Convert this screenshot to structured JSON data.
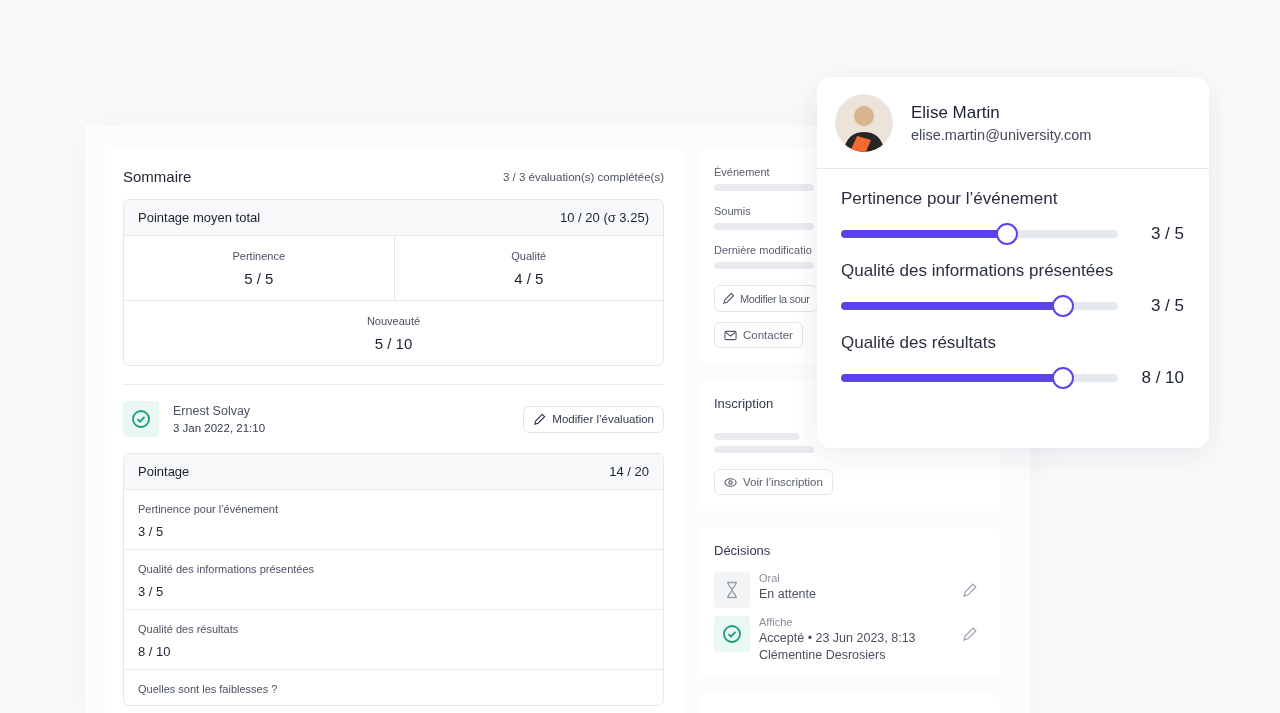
{
  "summary": {
    "title": "Sommaire",
    "completed": "3 / 3 évaluation(s) complétée(s)",
    "total": {
      "label": "Pointage moyen total",
      "value": "10 / 20 (σ 3.25)"
    },
    "criteria": [
      {
        "label": "Pertinence",
        "value": "5 / 5"
      },
      {
        "label": "Qualité",
        "value": "4 / 5"
      },
      {
        "label": "Nouveauté",
        "value": "5 / 10"
      }
    ]
  },
  "evaluation": {
    "reviewer": "Ernest Solvay",
    "date": "3 Jan 2022, 21:10",
    "edit_button": "Modifier l’évaluation",
    "score": {
      "label": "Pointage",
      "value": "14 / 20"
    },
    "fields": [
      {
        "label": "Pertinence pour l’événement",
        "value": "3 / 5"
      },
      {
        "label": "Qualité des informations présentées",
        "value": "3 / 5"
      },
      {
        "label": "Qualité des résultats",
        "value": "8 / 10"
      },
      {
        "label": "Quelles sont les faiblesses ?"
      }
    ]
  },
  "details": {
    "labels": [
      "Événement",
      "Soumis",
      "Dernière modificatio"
    ],
    "edit_button": "Modifier la sour",
    "contact_button": "Contacter"
  },
  "registration": {
    "title": "Inscription",
    "button": "Voir l’inscription"
  },
  "decisions": {
    "title": "Décisions",
    "items": [
      {
        "kind": "pending",
        "type": "Oral",
        "status": "En attente"
      },
      {
        "kind": "accepted",
        "type": "Affiche",
        "status": "Accepté • 23 Jun 2023, 8:13",
        "by": "Clémentine Desrosiers"
      }
    ]
  },
  "popover": {
    "name": "Elise Martin",
    "email": "elise.martin@university.com",
    "sliders": [
      {
        "label": "Pertinence pour l’événement",
        "level": 0.6,
        "reading": "3 / 5"
      },
      {
        "label": "Qualité des informations présentées",
        "level": 0.8,
        "reading": "3 / 5"
      },
      {
        "label": "Qualité des résultats",
        "level": 0.8,
        "reading": "8 / 10"
      }
    ]
  }
}
